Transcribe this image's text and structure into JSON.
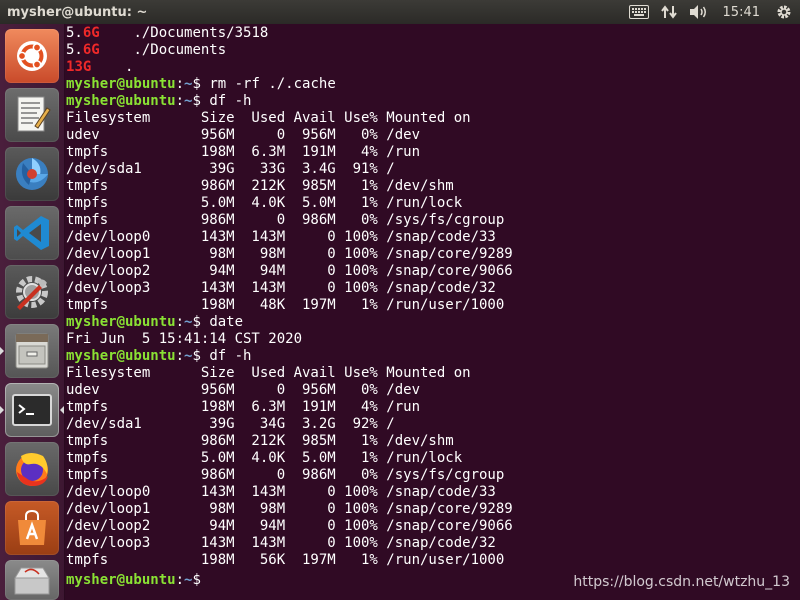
{
  "topbar": {
    "window_title": "mysher@ubuntu: ~",
    "clock": "15:41"
  },
  "launcher": {
    "items": [
      {
        "name": "ubuntu-dash",
        "icon": "ubuntu-logo-icon"
      },
      {
        "name": "text-editor",
        "icon": "text-editor-icon"
      },
      {
        "name": "shutter",
        "icon": "shutter-icon"
      },
      {
        "name": "vscode",
        "icon": "vscode-icon"
      },
      {
        "name": "settings",
        "icon": "settings-tools-icon"
      },
      {
        "name": "file-manager",
        "icon": "file-cabinet-icon"
      },
      {
        "name": "terminal",
        "icon": "terminal-icon"
      },
      {
        "name": "firefox",
        "icon": "firefox-icon"
      },
      {
        "name": "software-center",
        "icon": "software-bag-icon"
      },
      {
        "name": "trash",
        "icon": "trash-icon"
      }
    ]
  },
  "terminal": {
    "user": "mysher@ubuntu",
    "lines": [
      {
        "type": "du",
        "size": "5.6G",
        "size_num": "5.",
        "size_unit": "6G",
        "path": "./Documents/3518"
      },
      {
        "type": "du",
        "size": "5.6G",
        "size_num": "5.",
        "size_unit": "6G",
        "path": "./Documents"
      },
      {
        "type": "du",
        "size": "13G",
        "size_num": "1",
        "size_unit": "3G",
        "path": "."
      },
      {
        "type": "prompt",
        "cwd": "~",
        "cmd": "rm -rf ./.cache"
      },
      {
        "type": "prompt",
        "cwd": "~",
        "cmd": "df -h"
      },
      {
        "type": "out",
        "text": "Filesystem      Size  Used Avail Use% Mounted on"
      },
      {
        "type": "out",
        "text": "udev            956M     0  956M   0% /dev"
      },
      {
        "type": "out",
        "text": "tmpfs           198M  6.3M  191M   4% /run"
      },
      {
        "type": "out",
        "text": "/dev/sda1        39G   33G  3.4G  91% /"
      },
      {
        "type": "out",
        "text": "tmpfs           986M  212K  985M   1% /dev/shm"
      },
      {
        "type": "out",
        "text": "tmpfs           5.0M  4.0K  5.0M   1% /run/lock"
      },
      {
        "type": "out",
        "text": "tmpfs           986M     0  986M   0% /sys/fs/cgroup"
      },
      {
        "type": "out",
        "text": "/dev/loop0      143M  143M     0 100% /snap/code/33"
      },
      {
        "type": "out",
        "text": "/dev/loop1       98M   98M     0 100% /snap/core/9289"
      },
      {
        "type": "out",
        "text": "/dev/loop2       94M   94M     0 100% /snap/core/9066"
      },
      {
        "type": "out",
        "text": "/dev/loop3      143M  143M     0 100% /snap/code/32"
      },
      {
        "type": "out",
        "text": "tmpfs           198M   48K  197M   1% /run/user/1000"
      },
      {
        "type": "prompt",
        "cwd": "~",
        "cmd": "date"
      },
      {
        "type": "out",
        "text": "Fri Jun  5 15:41:14 CST 2020"
      },
      {
        "type": "prompt",
        "cwd": "~",
        "cmd": "df -h"
      },
      {
        "type": "out",
        "text": "Filesystem      Size  Used Avail Use% Mounted on"
      },
      {
        "type": "out",
        "text": "udev            956M     0  956M   0% /dev"
      },
      {
        "type": "out",
        "text": "tmpfs           198M  6.3M  191M   4% /run"
      },
      {
        "type": "out",
        "text": "/dev/sda1        39G   34G  3.2G  92% /"
      },
      {
        "type": "out",
        "text": "tmpfs           986M  212K  985M   1% /dev/shm"
      },
      {
        "type": "out",
        "text": "tmpfs           5.0M  4.0K  5.0M   1% /run/lock"
      },
      {
        "type": "out",
        "text": "tmpfs           986M     0  986M   0% /sys/fs/cgroup"
      },
      {
        "type": "out",
        "text": "/dev/loop0      143M  143M     0 100% /snap/code/33"
      },
      {
        "type": "out",
        "text": "/dev/loop1       98M   98M     0 100% /snap/core/9289"
      },
      {
        "type": "out",
        "text": "/dev/loop2       94M   94M     0 100% /snap/core/9066"
      },
      {
        "type": "out",
        "text": "/dev/loop3      143M  143M     0 100% /snap/code/32"
      },
      {
        "type": "out",
        "text": "tmpfs           198M   56K  197M   1% /run/user/1000"
      },
      {
        "type": "prompt",
        "cwd": "~",
        "cmd": ""
      }
    ]
  },
  "watermark": "https://blog.csdn.net/wtzhu_13",
  "colors": {
    "terminal_bg": "#300a24",
    "prompt_green": "#8ae234",
    "path_blue": "#729fcf",
    "highlight_red": "#ef2929"
  }
}
